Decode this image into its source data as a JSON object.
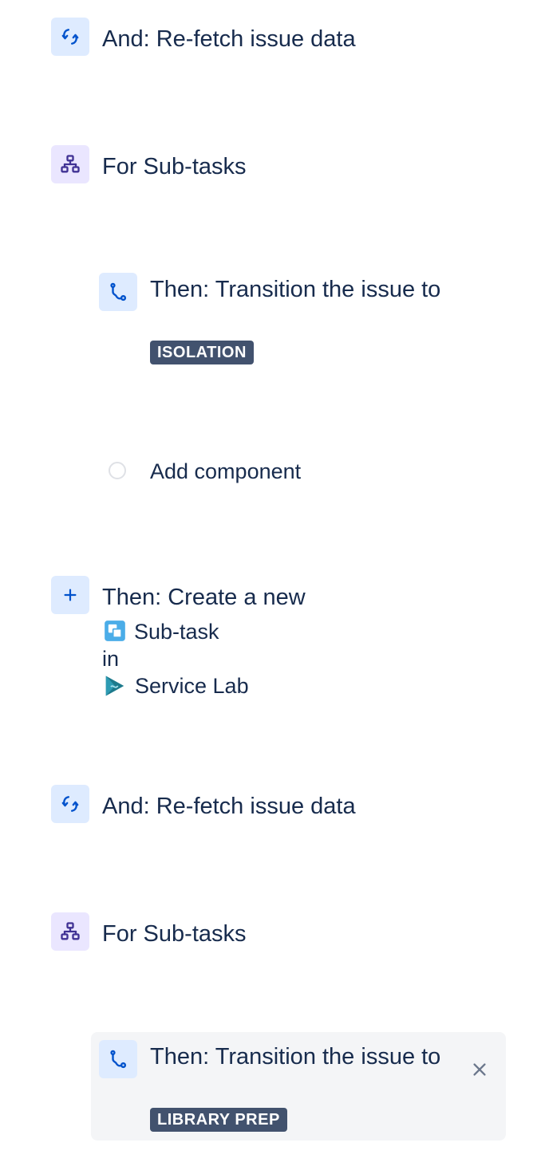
{
  "steps": [
    {
      "label": "And: Re-fetch issue data",
      "icon": "refresh-icon"
    },
    {
      "label": "For Sub-tasks",
      "icon": "branch-icon"
    },
    {
      "label": "Then: Transition the issue to",
      "status": "ISOLATION",
      "icon": "transition-icon"
    },
    {
      "label": "Add component",
      "icon": "add-component-circle-icon"
    },
    {
      "label": "Then: Create a new",
      "issue_type": "Sub-task",
      "connector": "in",
      "project": "Service Lab",
      "icon": "plus-icon"
    },
    {
      "label": "And: Re-fetch issue data",
      "icon": "refresh-icon"
    },
    {
      "label": "For Sub-tasks",
      "icon": "branch-icon"
    },
    {
      "label": "Then: Transition the issue to",
      "status": "LIBRARY PREP",
      "icon": "transition-icon",
      "close_icon": "close-icon"
    }
  ],
  "colors": {
    "text": "#172b4d",
    "blue_icon_bg": "#deebff",
    "purple_icon_bg": "#eae6ff",
    "lozenge_bg": "#42526e",
    "selected_card_bg": "#f4f5f7"
  }
}
